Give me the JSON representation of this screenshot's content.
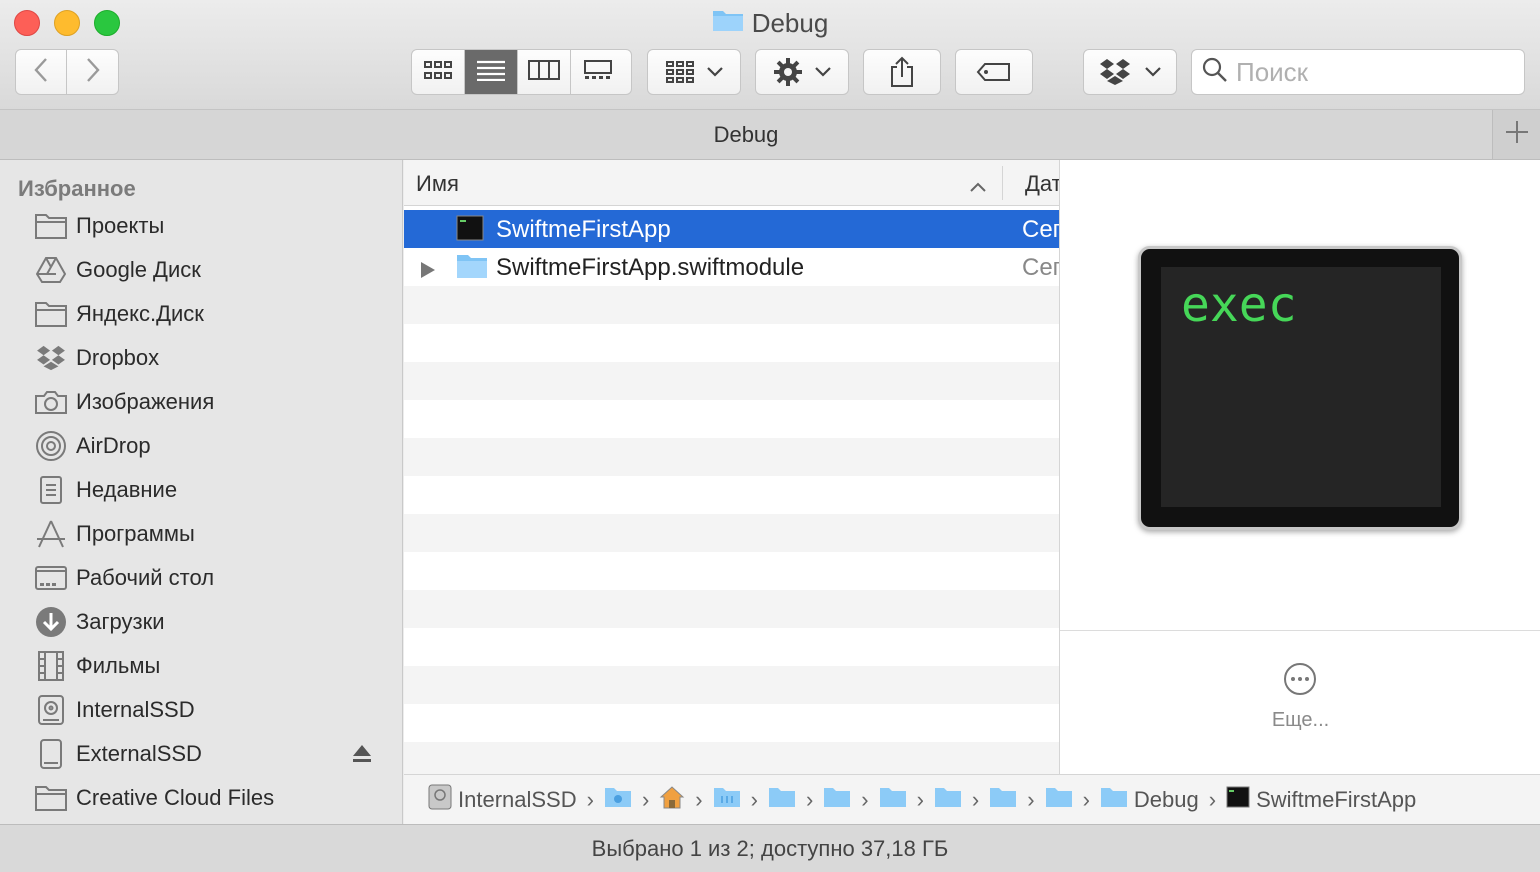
{
  "window": {
    "title": "Debug"
  },
  "toolbar": {
    "back_icon": "chevron-left-icon",
    "forward_icon": "chevron-right-icon",
    "view_modes": [
      "icon-view",
      "list-view",
      "column-view",
      "gallery-view"
    ],
    "active_view": "list-view",
    "search_placeholder": "Поиск"
  },
  "tab": {
    "title": "Debug"
  },
  "sidebar": {
    "header": "Избранное",
    "items": [
      {
        "label": "Проекты",
        "icon": "folder-icon"
      },
      {
        "label": "Google Диск",
        "icon": "google-drive-icon"
      },
      {
        "label": "Яндекс.Диск",
        "icon": "folder-icon"
      },
      {
        "label": "Dropbox",
        "icon": "dropbox-icon"
      },
      {
        "label": "Изображения",
        "icon": "camera-icon"
      },
      {
        "label": "AirDrop",
        "icon": "airdrop-icon"
      },
      {
        "label": "Недавние",
        "icon": "recents-icon"
      },
      {
        "label": "Программы",
        "icon": "applications-icon"
      },
      {
        "label": "Рабочий стол",
        "icon": "desktop-icon"
      },
      {
        "label": "Загрузки",
        "icon": "downloads-icon"
      },
      {
        "label": "Фильмы",
        "icon": "movies-icon"
      },
      {
        "label": "InternalSSD",
        "icon": "internal-disk-icon"
      },
      {
        "label": "ExternalSSD",
        "icon": "external-disk-icon"
      },
      {
        "label": "Creative Cloud Files",
        "icon": "folder-icon"
      }
    ]
  },
  "list": {
    "col_name": "Имя",
    "col_date": "Дат",
    "rows": [
      {
        "name": "SwiftmeFirstApp",
        "date": "Сег",
        "icon": "executable-icon",
        "selected": true
      },
      {
        "name": "SwiftmeFirstApp.swiftmodule",
        "date": "Сег",
        "icon": "folder-icon",
        "selected": false
      }
    ]
  },
  "preview": {
    "icon_text": "exec",
    "more_label": "Еще..."
  },
  "pathbar": {
    "items": [
      "InternalSSD",
      "",
      "",
      "",
      "",
      "",
      "",
      "",
      "",
      "",
      "Debug",
      "SwiftmeFirstApp"
    ]
  },
  "status": {
    "text": "Выбрано 1 из 2; доступно 37,18 ГБ"
  },
  "colors": {
    "selection": "#2469d6",
    "exec_text": "#46d758"
  }
}
